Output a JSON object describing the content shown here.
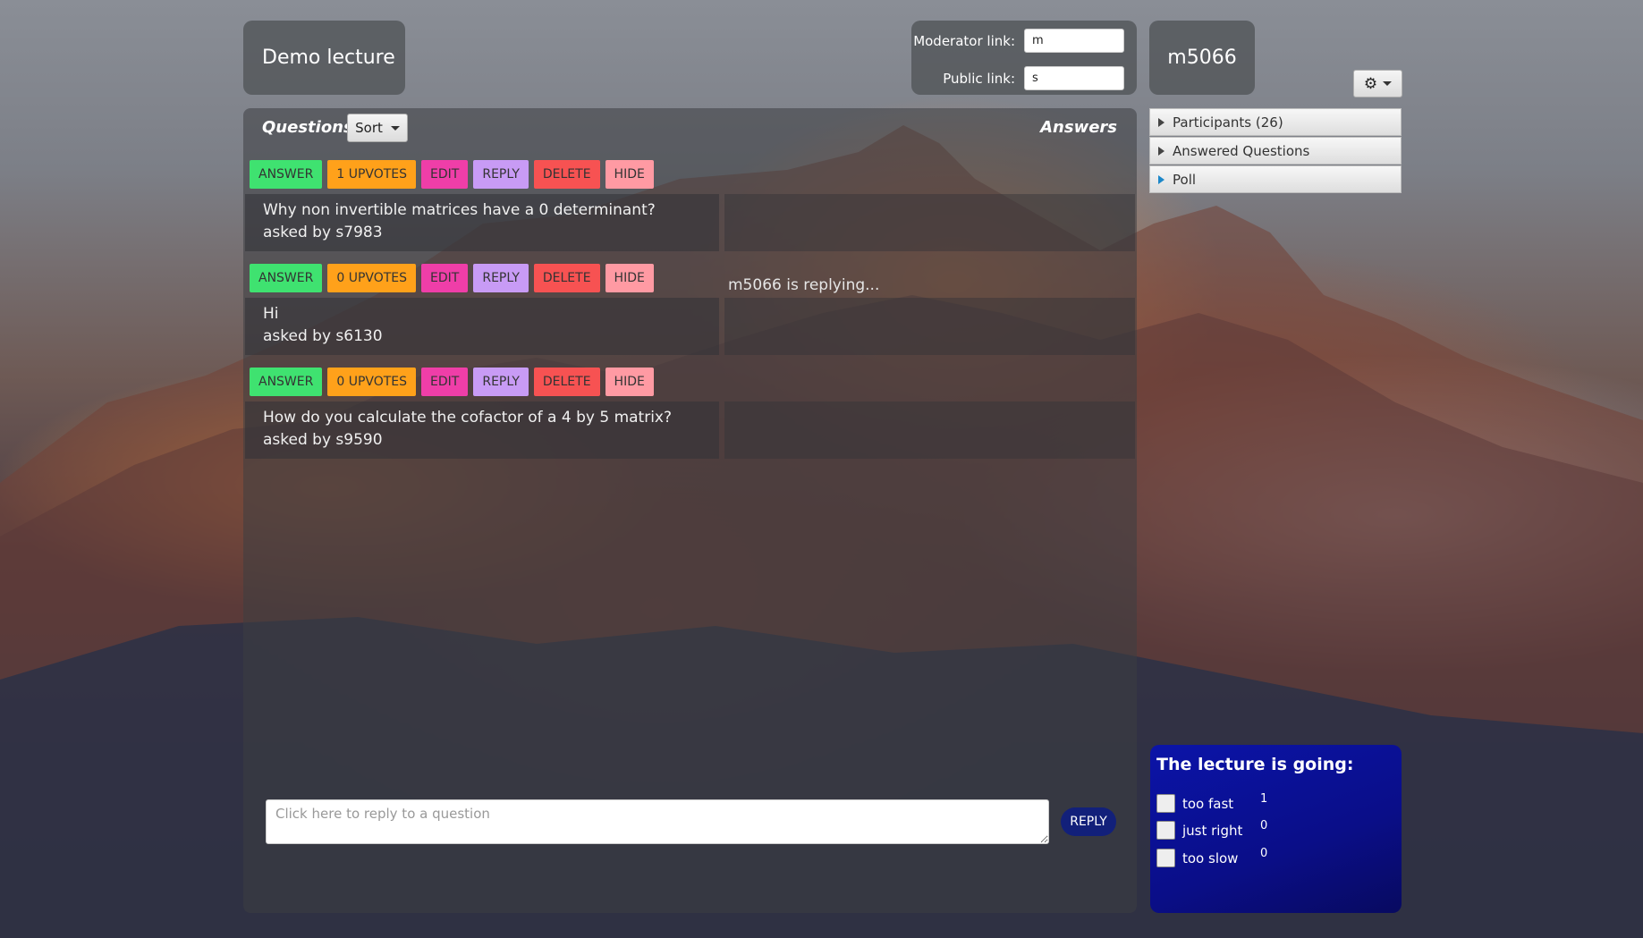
{
  "header": {
    "lecture_title": "Demo lecture",
    "moderator_link_label": "Moderator link:",
    "moderator_link_value": "m",
    "public_link_label": "Public link:",
    "public_link_value": "s",
    "user_code": "m5066",
    "settings_icon": "gear-icon"
  },
  "questions_panel": {
    "questions_heading": "Questions",
    "sort_label": "Sort",
    "answers_heading": "Answers",
    "questions": [
      {
        "text": "Why non invertible matrices have a 0 determinant?",
        "asked_by": "asked by s7983",
        "buttons": {
          "answer": "ANSWER",
          "upvotes": "1 UPVOTES",
          "edit": "EDIT",
          "reply": "REPLY",
          "delete": "DELETE",
          "hide": "HIDE"
        }
      },
      {
        "text": "Hi",
        "asked_by": "asked by s6130",
        "buttons": {
          "answer": "ANSWER",
          "upvotes": "0 UPVOTES",
          "edit": "EDIT",
          "reply": "REPLY",
          "delete": "DELETE",
          "hide": "HIDE"
        },
        "status": "m5066 is replying..."
      },
      {
        "text": "How do you calculate the cofactor of a 4 by 5 matrix?",
        "asked_by": "asked by s9590",
        "buttons": {
          "answer": "ANSWER",
          "upvotes": "0 UPVOTES",
          "edit": "EDIT",
          "reply": "REPLY",
          "delete": "DELETE",
          "hide": "HIDE"
        }
      }
    ],
    "reply_placeholder": "Click here to reply to a question",
    "reply_button": "REPLY"
  },
  "sidebar": {
    "items": [
      {
        "label": "Participants (26)"
      },
      {
        "label": "Answered Questions"
      },
      {
        "label": "Poll"
      }
    ]
  },
  "feedback": {
    "title": "The lecture is going:",
    "options": [
      {
        "label": "too fast",
        "count": "1"
      },
      {
        "label": "just right",
        "count": "0"
      },
      {
        "label": "too slow",
        "count": "0"
      }
    ]
  },
  "colors": {
    "answer": "#3fe270",
    "upvotes": "#ffa11a",
    "edit": "#ef3ea8",
    "reply": "#c89bf5",
    "delete": "#f75252",
    "hide": "#ff9aa3",
    "reply_submit": "#12207a",
    "feedback_bg": "#0b14a8"
  }
}
